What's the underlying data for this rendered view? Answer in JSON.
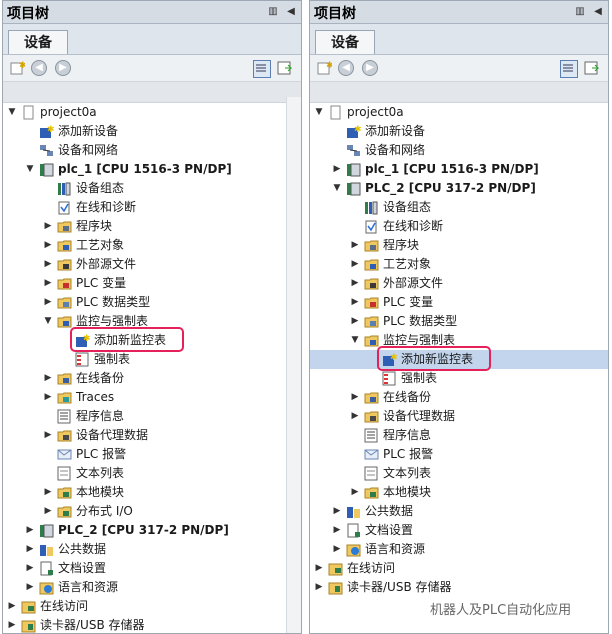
{
  "panels": [
    {
      "id": "left",
      "title": "项目树",
      "tab": "设备",
      "rows": [
        {
          "depth": 0,
          "toggle": "down",
          "icon": "project",
          "label": "project0a",
          "bold": false
        },
        {
          "depth": 1,
          "toggle": "",
          "icon": "add-device",
          "label": "添加新设备",
          "bold": false
        },
        {
          "depth": 1,
          "toggle": "",
          "icon": "network",
          "label": "设备和网络",
          "bold": false
        },
        {
          "depth": 1,
          "toggle": "down",
          "icon": "plc",
          "label": "plc_1 [CPU 1516-3 PN/DP]",
          "bold": true
        },
        {
          "depth": 2,
          "toggle": "",
          "icon": "config",
          "label": "设备组态",
          "bold": false
        },
        {
          "depth": 2,
          "toggle": "",
          "icon": "diag",
          "label": "在线和诊断",
          "bold": false
        },
        {
          "depth": 2,
          "toggle": "right",
          "icon": "folder-blocks",
          "label": "程序块",
          "bold": false
        },
        {
          "depth": 2,
          "toggle": "right",
          "icon": "folder-tech",
          "label": "工艺对象",
          "bold": false
        },
        {
          "depth": 2,
          "toggle": "right",
          "icon": "folder-src",
          "label": "外部源文件",
          "bold": false
        },
        {
          "depth": 2,
          "toggle": "right",
          "icon": "folder-tags",
          "label": "PLC 变量",
          "bold": false
        },
        {
          "depth": 2,
          "toggle": "right",
          "icon": "folder-types",
          "label": "PLC 数据类型",
          "bold": false
        },
        {
          "depth": 2,
          "toggle": "down",
          "icon": "folder-watch",
          "label": "监控与强制表",
          "bold": false
        },
        {
          "depth": 3,
          "toggle": "",
          "icon": "add-watch",
          "label": "添加新监控表",
          "bold": false,
          "highlight": true
        },
        {
          "depth": 3,
          "toggle": "",
          "icon": "force-table",
          "label": "强制表",
          "bold": false
        },
        {
          "depth": 2,
          "toggle": "right",
          "icon": "folder-backup",
          "label": "在线备份",
          "bold": false
        },
        {
          "depth": 2,
          "toggle": "right",
          "icon": "folder-traces",
          "label": "Traces",
          "bold": false
        },
        {
          "depth": 2,
          "toggle": "",
          "icon": "program-info",
          "label": "程序信息",
          "bold": false
        },
        {
          "depth": 2,
          "toggle": "right",
          "icon": "folder-proxy",
          "label": "设备代理数据",
          "bold": false
        },
        {
          "depth": 2,
          "toggle": "",
          "icon": "alarm",
          "label": "PLC 报警",
          "bold": false
        },
        {
          "depth": 2,
          "toggle": "",
          "icon": "text-list",
          "label": "文本列表",
          "bold": false
        },
        {
          "depth": 2,
          "toggle": "right",
          "icon": "folder-local",
          "label": "本地模块",
          "bold": false
        },
        {
          "depth": 2,
          "toggle": "right",
          "icon": "folder-io",
          "label": "分布式 I/O",
          "bold": false
        },
        {
          "depth": 1,
          "toggle": "right",
          "icon": "plc",
          "label": "PLC_2 [CPU 317-2 PN/DP]",
          "bold": true
        },
        {
          "depth": 1,
          "toggle": "right",
          "icon": "common-data",
          "label": "公共数据",
          "bold": false
        },
        {
          "depth": 1,
          "toggle": "right",
          "icon": "doc-settings",
          "label": "文档设置",
          "bold": false
        },
        {
          "depth": 1,
          "toggle": "right",
          "icon": "languages",
          "label": "语言和资源",
          "bold": false
        },
        {
          "depth": 0,
          "toggle": "right",
          "icon": "online",
          "label": "在线访问",
          "bold": false
        },
        {
          "depth": 0,
          "toggle": "right",
          "icon": "card-reader",
          "label": "读卡器/USB 存储器",
          "bold": false
        }
      ]
    },
    {
      "id": "right",
      "title": "项目树",
      "tab": "设备",
      "rows": [
        {
          "depth": 0,
          "toggle": "down",
          "icon": "project",
          "label": "project0a",
          "bold": false
        },
        {
          "depth": 1,
          "toggle": "",
          "icon": "add-device",
          "label": "添加新设备",
          "bold": false
        },
        {
          "depth": 1,
          "toggle": "",
          "icon": "network",
          "label": "设备和网络",
          "bold": false
        },
        {
          "depth": 1,
          "toggle": "right",
          "icon": "plc",
          "label": "plc_1 [CPU 1516-3 PN/DP]",
          "bold": true
        },
        {
          "depth": 1,
          "toggle": "down",
          "icon": "plc",
          "label": "PLC_2 [CPU 317-2 PN/DP]",
          "bold": true
        },
        {
          "depth": 2,
          "toggle": "",
          "icon": "config",
          "label": "设备组态",
          "bold": false
        },
        {
          "depth": 2,
          "toggle": "",
          "icon": "diag",
          "label": "在线和诊断",
          "bold": false
        },
        {
          "depth": 2,
          "toggle": "right",
          "icon": "folder-blocks",
          "label": "程序块",
          "bold": false
        },
        {
          "depth": 2,
          "toggle": "right",
          "icon": "folder-tech",
          "label": "工艺对象",
          "bold": false
        },
        {
          "depth": 2,
          "toggle": "right",
          "icon": "folder-src",
          "label": "外部源文件",
          "bold": false
        },
        {
          "depth": 2,
          "toggle": "right",
          "icon": "folder-tags",
          "label": "PLC 变量",
          "bold": false
        },
        {
          "depth": 2,
          "toggle": "right",
          "icon": "folder-types",
          "label": "PLC 数据类型",
          "bold": false
        },
        {
          "depth": 2,
          "toggle": "down",
          "icon": "folder-watch",
          "label": "监控与强制表",
          "bold": false
        },
        {
          "depth": 3,
          "toggle": "",
          "icon": "add-watch",
          "label": "添加新监控表",
          "bold": false,
          "highlight": true,
          "selected": true
        },
        {
          "depth": 3,
          "toggle": "",
          "icon": "force-table",
          "label": "强制表",
          "bold": false
        },
        {
          "depth": 2,
          "toggle": "right",
          "icon": "folder-backup",
          "label": "在线备份",
          "bold": false
        },
        {
          "depth": 2,
          "toggle": "right",
          "icon": "folder-proxy",
          "label": "设备代理数据",
          "bold": false
        },
        {
          "depth": 2,
          "toggle": "",
          "icon": "program-info",
          "label": "程序信息",
          "bold": false
        },
        {
          "depth": 2,
          "toggle": "",
          "icon": "alarm",
          "label": "PLC 报警",
          "bold": false
        },
        {
          "depth": 2,
          "toggle": "",
          "icon": "text-list",
          "label": "文本列表",
          "bold": false
        },
        {
          "depth": 2,
          "toggle": "right",
          "icon": "folder-local",
          "label": "本地模块",
          "bold": false
        },
        {
          "depth": 1,
          "toggle": "right",
          "icon": "common-data",
          "label": "公共数据",
          "bold": false
        },
        {
          "depth": 1,
          "toggle": "right",
          "icon": "doc-settings",
          "label": "文档设置",
          "bold": false
        },
        {
          "depth": 1,
          "toggle": "right",
          "icon": "languages",
          "label": "语言和资源",
          "bold": false
        },
        {
          "depth": 0,
          "toggle": "right",
          "icon": "online",
          "label": "在线访问",
          "bold": false
        },
        {
          "depth": 0,
          "toggle": "right",
          "icon": "card-reader",
          "label": "读卡器/USB 存储器",
          "bold": false
        }
      ]
    }
  ],
  "watermark": "机器人及PLC自动化应用",
  "colors": {
    "highlight": "#e5215b",
    "selection": "#c3d5ec",
    "titlebar": "#d5dce4"
  }
}
